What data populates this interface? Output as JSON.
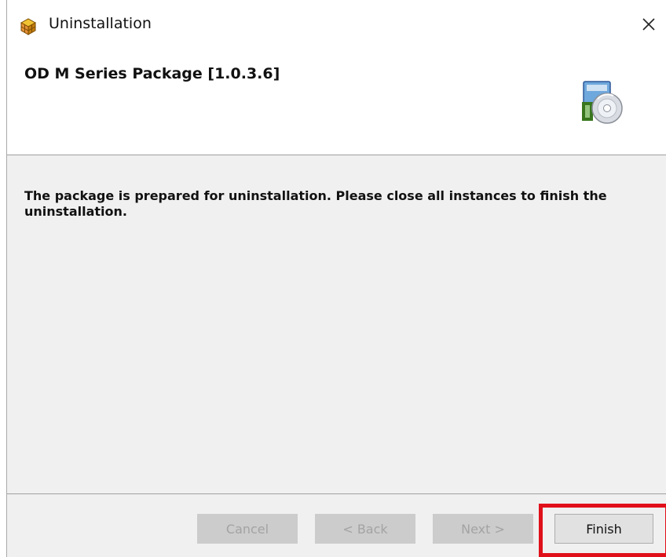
{
  "window": {
    "title": "Uninstallation",
    "close_icon": "close-icon"
  },
  "header": {
    "title": "OD M Series Package [1.0.3.6]",
    "icon": "package-disc-icon"
  },
  "content": {
    "message": "The package is prepared for uninstallation. Please close all instances to finish the uninstallation."
  },
  "buttons": {
    "cancel": "Cancel",
    "back": "< Back",
    "next": "Next >",
    "finish": "Finish"
  },
  "colors": {
    "highlight": "#e0101a",
    "panel_background": "#f0f0f0",
    "disabled_button": "#cccccc"
  }
}
